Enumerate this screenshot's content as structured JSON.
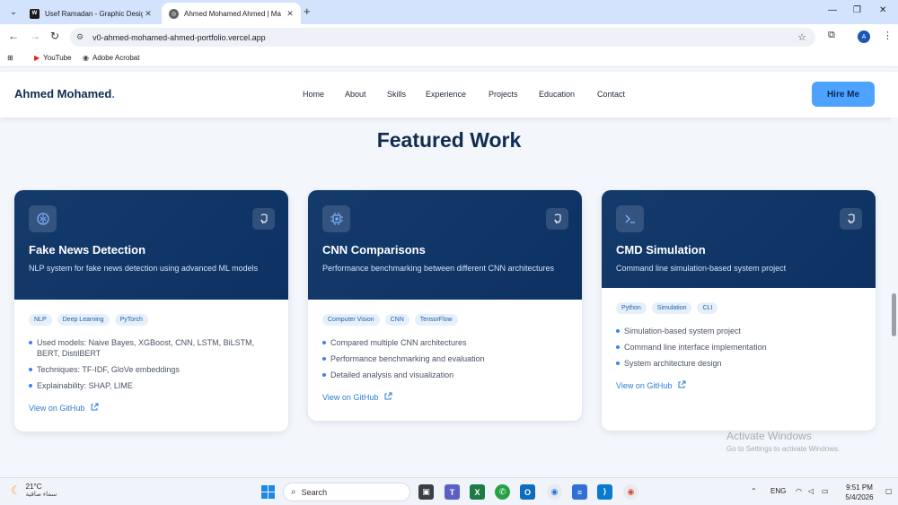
{
  "browser": {
    "tabs": [
      {
        "title": "Usef Ramadan - Graphic Design",
        "favicon": "w-logo-icon",
        "active": false
      },
      {
        "title": "Ahmed Mohamed Ahmed | Ma",
        "favicon": "globe-icon",
        "active": true
      }
    ],
    "url": "v0-ahmed-mohamed-ahmed-portfolio.vercel.app",
    "profile_initial": "A",
    "bookmarks": [
      {
        "label": "YouTube",
        "icon": "youtube-icon"
      },
      {
        "label": "Adobe Acrobat",
        "icon": "acrobat-icon"
      }
    ]
  },
  "site": {
    "brand": "Ahmed Mohamed",
    "brand_dot": ".",
    "nav": [
      "Home",
      "About",
      "Skills",
      "Experience",
      "Projects",
      "Education",
      "Contact"
    ],
    "hire_label": "Hire Me",
    "section_title": "Featured Work",
    "projects": [
      {
        "icon": "brain-icon",
        "title": "Fake News Detection",
        "description": "NLP system for fake news detection using advanced ML models",
        "tags": [
          "NLP",
          "Deep Learning",
          "PyTorch"
        ],
        "bullets": [
          "Used models: Naive Bayes, XGBoost, CNN, LSTM, BiLSTM, BERT, DistilBERT",
          "Techniques: TF-IDF, GloVe embeddings",
          "Explainability: SHAP, LIME"
        ],
        "link": "View on GitHub"
      },
      {
        "icon": "cpu-icon",
        "title": "CNN Comparisons",
        "description": "Performance benchmarking between different CNN architectures",
        "tags": [
          "Computer Vision",
          "CNN",
          "TensorFlow"
        ],
        "bullets": [
          "Compared multiple CNN architectures",
          "Performance benchmarking and evaluation",
          "Detailed analysis and visualization"
        ],
        "link": "View on GitHub"
      },
      {
        "icon": "terminal-icon",
        "title": "CMD Simulation",
        "description": "Command line simulation-based system project",
        "tags": [
          "Python",
          "Simulation",
          "CLI"
        ],
        "bullets": [
          "Simulation-based system project",
          "Command line interface implementation",
          "System architecture design"
        ],
        "link": "View on GitHub"
      }
    ]
  },
  "watermark": {
    "line1": "Activate Windows",
    "line2": "Go to Settings to activate Windows."
  },
  "taskbar": {
    "temperature": "21°C",
    "weather_text": "سماء صافية",
    "search_label": "Search",
    "language": "ENG",
    "time": "9:51 PM",
    "date": "5/4/2026"
  },
  "colors": {
    "navy": "#0f2c52",
    "card_header": "#143a6c",
    "accent": "#3b82f6",
    "hire_button": "#4da3ff"
  }
}
